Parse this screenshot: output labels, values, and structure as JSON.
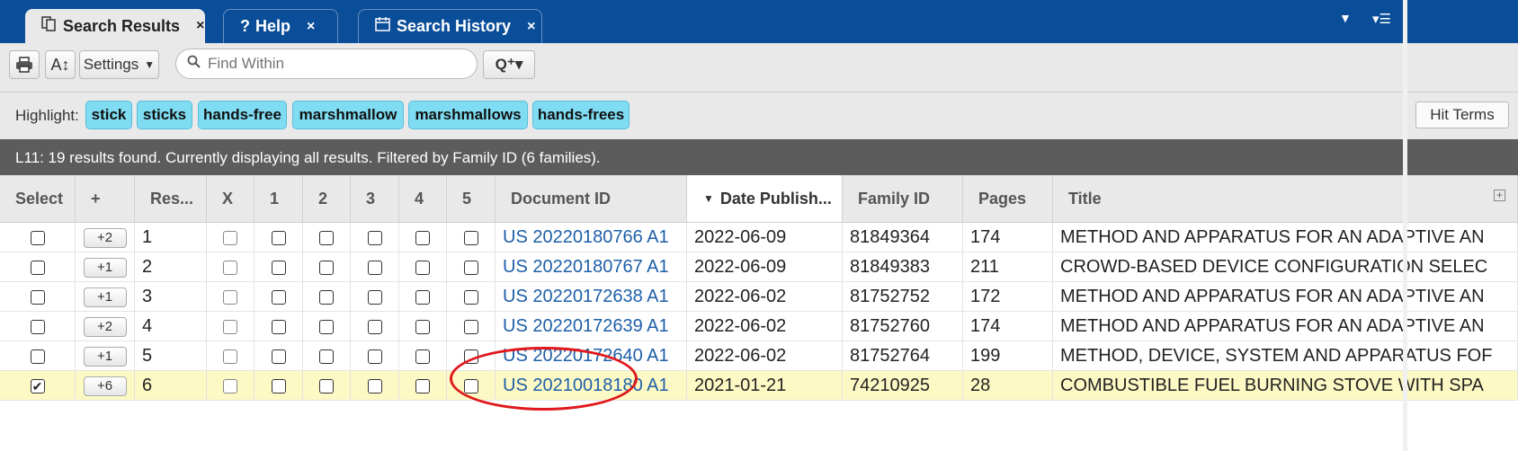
{
  "tabs": [
    {
      "label": "Search Results",
      "icon": "documents-icon",
      "close": "×",
      "active": true
    },
    {
      "label": "Help",
      "icon": "question-icon",
      "close": "×",
      "active": false
    },
    {
      "label": "Search History",
      "icon": "calendar-icon",
      "close": "×",
      "active": false
    }
  ],
  "window_menu": {
    "dropdown": "▼",
    "list_menu": "▾☰"
  },
  "toolbar": {
    "print_icon": "print-icon",
    "font_icon": "A↕",
    "settings_label": "Settings",
    "settings_caret": "▼",
    "search_placeholder": "Find Within",
    "search_options_label": "Q⁺▾"
  },
  "highlight": {
    "label": "Highlight:",
    "terms": [
      "stick",
      "sticks",
      "hands-free",
      "marshmallow",
      "marshmallows",
      "hands-frees"
    ],
    "hit_terms_label": "Hit Terms"
  },
  "status": "L11:  19 results found. Currently displaying all results. Filtered by Family ID (6 families).",
  "columns": [
    "Select",
    "+",
    "Res...",
    "X",
    "1",
    "2",
    "3",
    "4",
    "5",
    "Document ID",
    "Date Publish...",
    "Family ID",
    "Pages",
    "Title"
  ],
  "sort_indicator": "▼",
  "rows": [
    {
      "selected": false,
      "family": "+2",
      "result": "1",
      "doc_id": "US 20220180766 A1",
      "date": "2022-06-09",
      "family_id": "81849364",
      "pages": "174",
      "title": "METHOD AND APPARATUS FOR AN ADAPTIVE AN"
    },
    {
      "selected": false,
      "family": "+1",
      "result": "2",
      "doc_id": "US 20220180767 A1",
      "date": "2022-06-09",
      "family_id": "81849383",
      "pages": "211",
      "title": "CROWD-BASED DEVICE CONFIGURATION SELEC"
    },
    {
      "selected": false,
      "family": "+1",
      "result": "3",
      "doc_id": "US 20220172638 A1",
      "date": "2022-06-02",
      "family_id": "81752752",
      "pages": "172",
      "title": "METHOD AND APPARATUS FOR AN ADAPTIVE AN"
    },
    {
      "selected": false,
      "family": "+2",
      "result": "4",
      "doc_id": "US 20220172639 A1",
      "date": "2022-06-02",
      "family_id": "81752760",
      "pages": "174",
      "title": "METHOD AND APPARATUS FOR AN ADAPTIVE AN"
    },
    {
      "selected": false,
      "family": "+1",
      "result": "5",
      "doc_id": "US 20220172640 A1",
      "date": "2022-06-02",
      "family_id": "81752764",
      "pages": "199",
      "title": "METHOD, DEVICE, SYSTEM AND APPARATUS FOF"
    },
    {
      "selected": true,
      "family": "+6",
      "result": "6",
      "doc_id": "US 20210018180 A1",
      "date": "2021-01-21",
      "family_id": "74210925",
      "pages": "28",
      "title": "COMBUSTIBLE FUEL BURNING STOVE WITH SPA"
    }
  ],
  "colors": {
    "tabbar": "#0a4d99",
    "highlight_term": "#7fdcf2",
    "selected_row": "#fdf9c4",
    "link": "#1e5fa8",
    "annotation": "#e0181c"
  }
}
